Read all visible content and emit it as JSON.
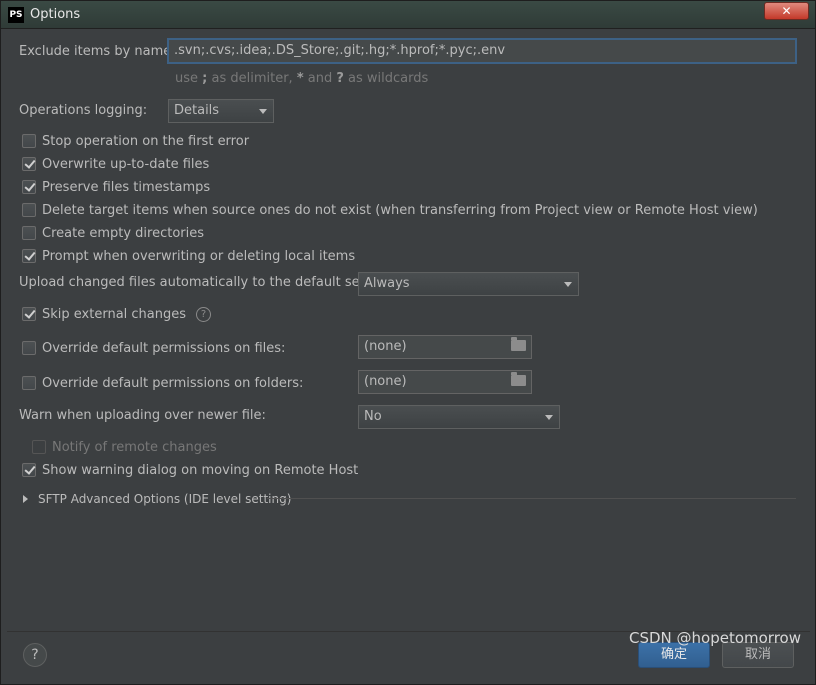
{
  "window": {
    "title": "Options",
    "app_icon": "PS",
    "close_label": "✕"
  },
  "exclude": {
    "label": "Exclude items by name:",
    "value": ".svn;.cvs;.idea;.DS_Store;.git;.hg;*.hprof;*.pyc;.env",
    "hint_prefix": "use ",
    "hint_semicolon": ";",
    "hint_mid": " as delimiter, ",
    "hint_star": "*",
    "hint_and": " and ",
    "hint_q": "?",
    "hint_suffix": " as wildcards"
  },
  "logging": {
    "label": "Operations logging:",
    "value": "Details"
  },
  "checkboxes": [
    {
      "label": "Stop operation on the first error",
      "checked": false
    },
    {
      "label": "Overwrite up-to-date files",
      "checked": true
    },
    {
      "label": "Preserve files timestamps",
      "checked": true
    },
    {
      "label": "Delete target items when source ones do not exist (when transferring from Project view or Remote Host view)",
      "checked": false
    },
    {
      "label": "Create empty directories",
      "checked": false
    },
    {
      "label": "Prompt when overwriting or deleting local items",
      "checked": true
    }
  ],
  "upload": {
    "label": "Upload changed files automatically to the default server",
    "value": "Always"
  },
  "skip_external": {
    "label": "Skip external changes",
    "checked": true,
    "help": "?"
  },
  "perm_files": {
    "label": "Override default permissions on files:",
    "checked": false,
    "value": "(none)"
  },
  "perm_folders": {
    "label": "Override default permissions on folders:",
    "checked": false,
    "value": "(none)"
  },
  "warn_newer": {
    "label": "Warn when uploading over newer file:",
    "value": "No"
  },
  "notify_remote": {
    "label": "Notify of remote changes",
    "checked": false,
    "disabled": true
  },
  "show_warning": {
    "label": "Show warning dialog on moving on Remote Host",
    "checked": true
  },
  "sftp": {
    "label": "SFTP Advanced Options (IDE level setting)"
  },
  "footer": {
    "help": "?",
    "ok_label": "确定",
    "cancel_label": "取消"
  },
  "watermark": "CSDN @hopetomorrow"
}
